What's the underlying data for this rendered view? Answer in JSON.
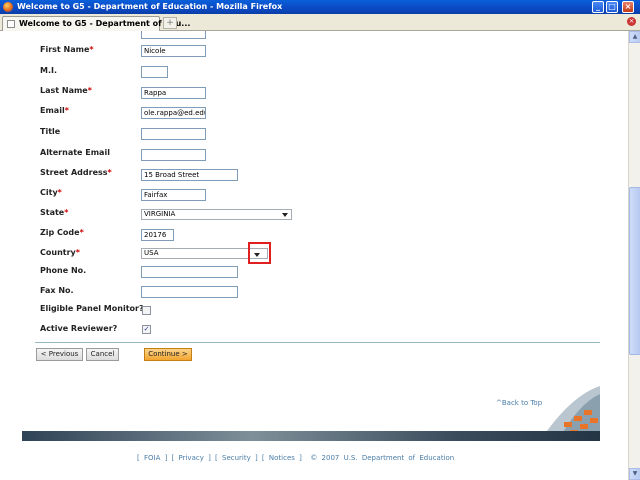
{
  "window": {
    "title": "Welcome to G5 - Department of Education - Mozilla Firefox",
    "controls": {
      "minimize": "_",
      "maximize": "□",
      "close": "×"
    }
  },
  "tabs": [
    {
      "label": "Welcome to G5 - Department of Edu...",
      "active": true
    }
  ],
  "new_tab_label": "+",
  "form": {
    "first_name": {
      "label": "First Name",
      "value": "Nicole",
      "required": true
    },
    "mi": {
      "label": "M.I.",
      "value": ""
    },
    "last_name": {
      "label": "Last Name",
      "value": "Rappa",
      "required": true
    },
    "email": {
      "label": "Email",
      "value": "ole.rappa@ed.edu",
      "required": true
    },
    "title": {
      "label": "Title",
      "value": ""
    },
    "alternate_email": {
      "label": "Alternate Email",
      "value": ""
    },
    "street_address": {
      "label": "Street Address",
      "value": "15 Broad Street",
      "required": true
    },
    "city": {
      "label": "City",
      "value": "Fairfax",
      "required": true
    },
    "state": {
      "label": "State",
      "value": "VIRGINIA",
      "required": true
    },
    "zip_code": {
      "label": "Zip Code",
      "value": "20176",
      "required": true
    },
    "country": {
      "label": "Country",
      "value": "USA",
      "required": true
    },
    "phone": {
      "label": "Phone No.",
      "value": ""
    },
    "fax": {
      "label": "Fax No.",
      "value": ""
    },
    "eligible_panel_monitor": {
      "label": "Eligible Panel Monitor?",
      "checked": false
    },
    "active_reviewer": {
      "label": "Active Reviewer?",
      "checked": true
    },
    "required_marker": "*"
  },
  "buttons": {
    "previous": "< Previous",
    "cancel": "Cancel",
    "continue": "Continue >"
  },
  "back_to_top": "^Back to Top",
  "footer": {
    "foia": "FOIA",
    "privacy": "Privacy",
    "security": "Security",
    "notices": "Notices",
    "copyright": "© 2007 U.S. Department of Education"
  },
  "colors": {
    "required": "#cc0000",
    "link": "#4a7da8",
    "highlight": "#e02020",
    "primary_button": "#f2a62e"
  }
}
